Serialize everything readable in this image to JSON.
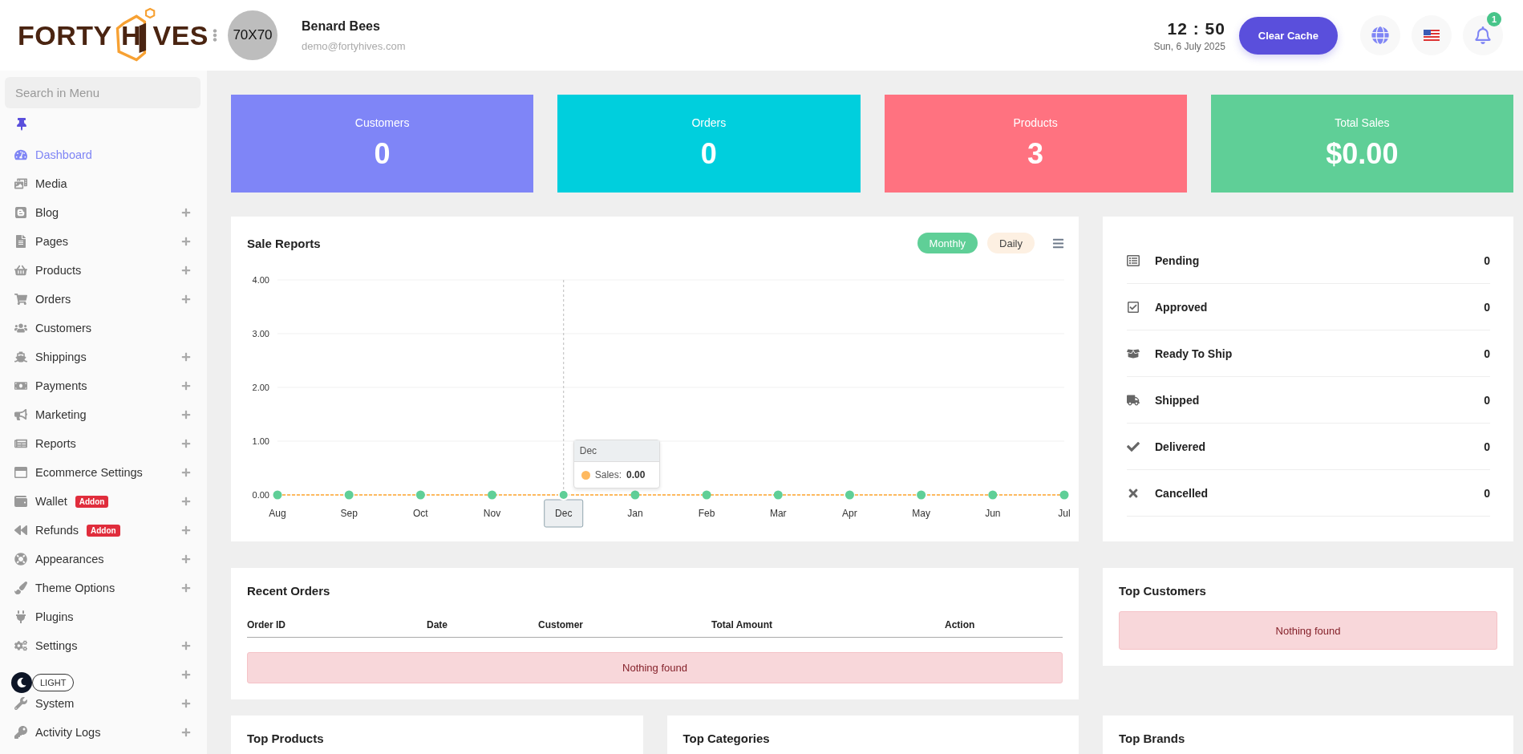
{
  "header": {
    "logo": {
      "left": "FORTY",
      "middle": "H",
      "right": "VES"
    },
    "avatar": {
      "text": "70X70"
    },
    "user": {
      "name": "Benard Bees",
      "email": "demo@fortyhives.com"
    },
    "clock": {
      "time": "12 : 50",
      "date": "Sun, 6 July 2025"
    },
    "clear_cache": "Clear Cache",
    "notifications": {
      "count": "1"
    }
  },
  "sidebar": {
    "search": {
      "placeholder": "Search in Menu"
    },
    "items": [
      {
        "label": "Dashboard",
        "selected": true,
        "expandable": false
      },
      {
        "label": "Media",
        "selected": false,
        "expandable": false
      },
      {
        "label": "Blog",
        "selected": false,
        "expandable": true
      },
      {
        "label": "Pages",
        "selected": false,
        "expandable": true
      },
      {
        "label": "Products",
        "selected": false,
        "expandable": true
      },
      {
        "label": "Orders",
        "selected": false,
        "expandable": true
      },
      {
        "label": "Customers",
        "selected": false,
        "expandable": false
      },
      {
        "label": "Shippings",
        "selected": false,
        "expandable": true
      },
      {
        "label": "Payments",
        "selected": false,
        "expandable": true
      },
      {
        "label": "Marketing",
        "selected": false,
        "expandable": true
      },
      {
        "label": "Reports",
        "selected": false,
        "expandable": true
      },
      {
        "label": "Ecommerce Settings",
        "selected": false,
        "expandable": true
      },
      {
        "label": "Wallet",
        "badge": "Addon",
        "selected": false,
        "expandable": true
      },
      {
        "label": "Refunds",
        "badge": "Addon",
        "selected": false,
        "expandable": true
      },
      {
        "label": "Appearances",
        "selected": false,
        "expandable": true
      },
      {
        "label": "Theme Options",
        "selected": false,
        "expandable": true
      },
      {
        "label": "Plugins",
        "selected": false,
        "expandable": false
      },
      {
        "label": "Settings",
        "selected": false,
        "expandable": true
      },
      {
        "selected": false,
        "expandable": true
      },
      {
        "label": "System",
        "selected": false,
        "expandable": true
      },
      {
        "label": "Activity Logs",
        "selected": false,
        "expandable": true
      }
    ],
    "theme_toggle": {
      "label": "LIGHT"
    }
  },
  "stats": [
    {
      "label": "Customers",
      "value": "0",
      "color": "#7f85f7"
    },
    {
      "label": "Orders",
      "value": "0",
      "color": "#00cfdd"
    },
    {
      "label": "Products",
      "value": "3",
      "color": "#ff7280"
    },
    {
      "label": "Total Sales",
      "value": "$0.00",
      "color": "#5fcf97"
    }
  ],
  "sale_reports": {
    "title": "Sale Reports",
    "periods": [
      {
        "label": "Monthly",
        "selected": true
      },
      {
        "label": "Daily",
        "selected": false
      }
    ],
    "chart_data": {
      "type": "line",
      "categories": [
        "Aug",
        "Sep",
        "Oct",
        "Nov",
        "Dec",
        "Jan",
        "Feb",
        "Mar",
        "Apr",
        "May",
        "Jun",
        "Jul"
      ],
      "series": [
        {
          "color": "#feb95f",
          "line_style": "dashed",
          "marker": "circle",
          "values": [
            0,
            0,
            0,
            0,
            0,
            0,
            0,
            0,
            0,
            0,
            0,
            0
          ]
        }
      ],
      "grid": true,
      "ref_lines": [
        {
          "axis": "x",
          "value": "Dec"
        }
      ],
      "ylim": [
        0,
        4
      ],
      "yticks": [
        {
          "value": 0,
          "label": "0.00"
        },
        {
          "value": 1,
          "label": "1.00"
        },
        {
          "value": 2,
          "label": "2.00"
        },
        {
          "value": 3,
          "label": "3.00"
        },
        {
          "value": 4,
          "label": "4.00"
        }
      ]
    },
    "tooltip": {
      "title": "Dec",
      "label": "Sales:",
      "value": "0.00"
    }
  },
  "order_status": [
    {
      "label": "Pending",
      "count": "0"
    },
    {
      "label": "Approved",
      "count": "0"
    },
    {
      "label": "Ready To Ship",
      "count": "0"
    },
    {
      "label": "Shipped",
      "count": "0"
    },
    {
      "label": "Delivered",
      "count": "0"
    },
    {
      "label": "Cancelled",
      "count": "0"
    }
  ],
  "recent_orders": {
    "title": "Recent Orders",
    "columns": [
      "Order ID",
      "Date",
      "Customer",
      "Total Amount",
      "Action"
    ],
    "empty": "Nothing found"
  },
  "top_customers": {
    "title": "Top Customers",
    "empty": "Nothing found"
  },
  "bottom_panels": [
    {
      "title": "Top Products"
    },
    {
      "title": "Top Categories"
    },
    {
      "title": "Top Brands"
    }
  ]
}
